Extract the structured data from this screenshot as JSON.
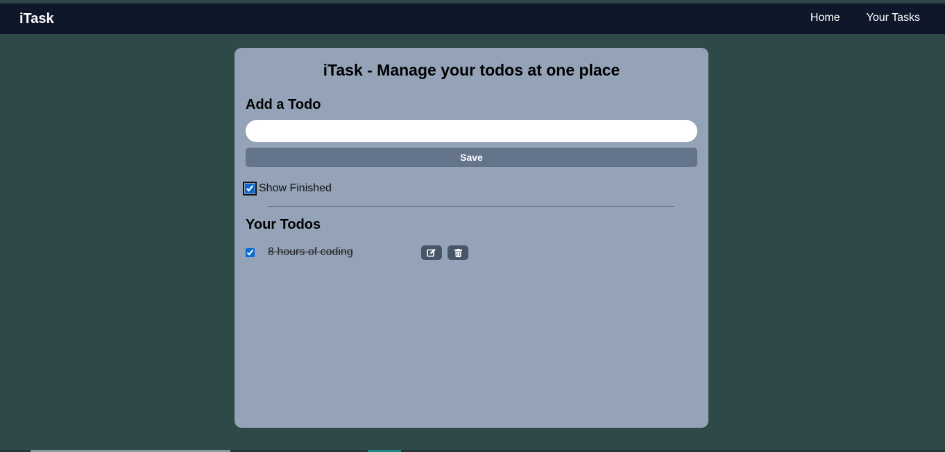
{
  "navbar": {
    "brand": "iTask",
    "links": [
      "Home",
      "Your Tasks"
    ]
  },
  "main": {
    "title": "iTask - Manage your todos at one place",
    "add_heading": "Add a Todo",
    "input": {
      "value": "",
      "placeholder": ""
    },
    "save_label": "Save",
    "show_finished": {
      "label": "Show Finished",
      "checked": true
    },
    "todos_heading": "Your Todos",
    "todos": [
      {
        "text": "8 hours of coding",
        "completed": true,
        "edit_icon": "edit-icon",
        "delete_icon": "trash-icon"
      }
    ]
  },
  "colors": {
    "page_bg": "#2f4848",
    "navbar_bg": "#0f172a",
    "card_bg": "#94a3b8",
    "save_button": "#64748b",
    "icon_button": "#475569",
    "checkbox_accent": "#0b6bd6"
  }
}
